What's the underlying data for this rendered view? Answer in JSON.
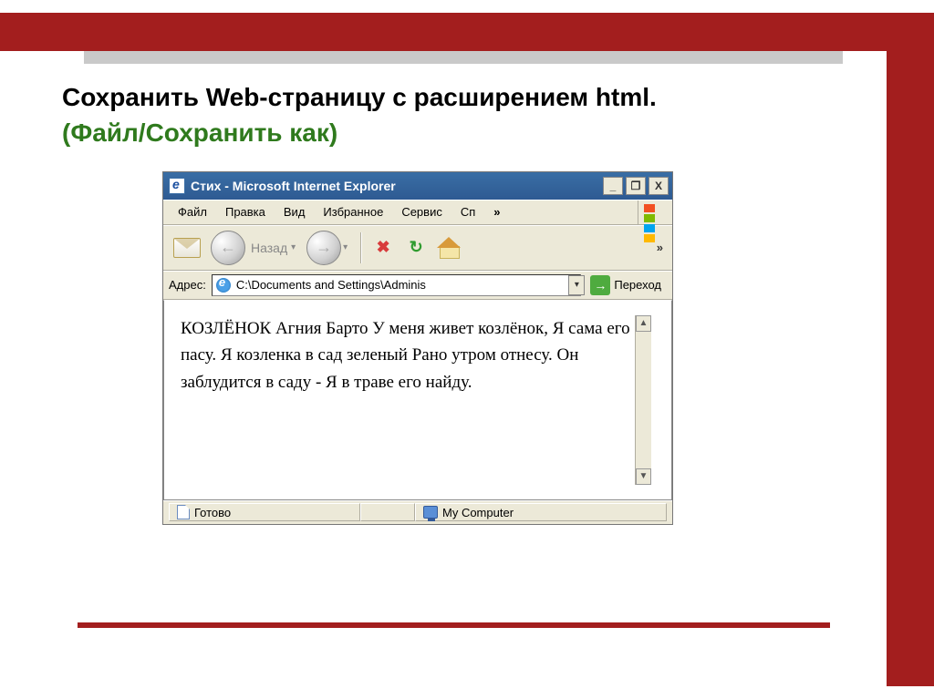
{
  "slide": {
    "title": "Сохранить  Web-страницу с расширением html.",
    "subtitle": "(Файл/Сохранить как)"
  },
  "window": {
    "title": "Стих - Microsoft Internet Explorer",
    "minimize": "_",
    "restore": "❐",
    "close": "X"
  },
  "menu": {
    "file": "Файл",
    "edit": "Правка",
    "view": "Вид",
    "favorites": "Избранное",
    "tools": "Сервис",
    "partial": "Сп",
    "overflow": "»"
  },
  "toolbar": {
    "back_label": "Назад",
    "back_arrow": "←",
    "fwd_arrow": "→",
    "caret": "▾",
    "stop": "✖",
    "refresh": "↻",
    "overflow": "»"
  },
  "address": {
    "label": "Адрес:",
    "value": "C:\\Documents and Settings\\Adminis",
    "go_arrow": "→",
    "go_label": "Переход",
    "caret": "▾"
  },
  "page_body": "КОЗЛЁНОК Агния Барто У меня живет козлёнок, Я сама его пасу. Я козленка в сад зеленый Рано утром отнесу. Он заблудится в саду - Я в траве его найду.",
  "scrollbar": {
    "up": "▲",
    "down": "▼"
  },
  "status": {
    "ready": "Готово",
    "zone": "My Computer"
  }
}
